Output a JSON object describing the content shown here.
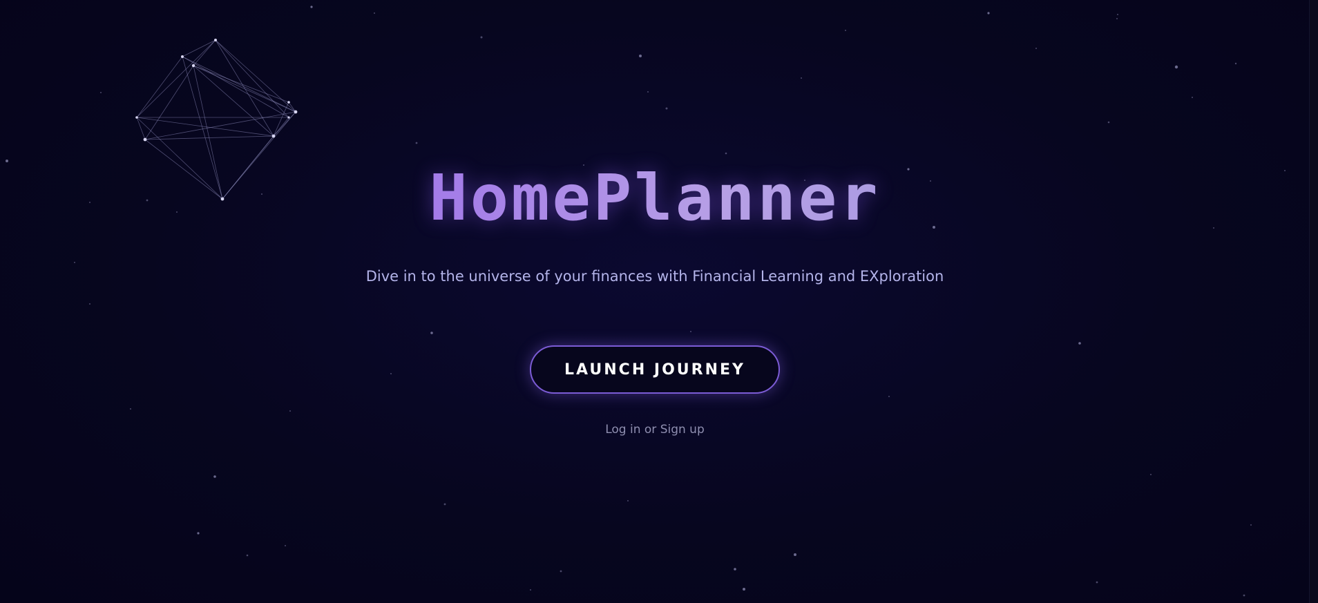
{
  "hero": {
    "title": "HomePlanner",
    "subtitle": "Dive in to the universe of your finances with Financial Learning and EXploration",
    "launch_button_label": "LAUNCH JOURNEY",
    "auth_link_label": "Log in or Sign up"
  },
  "decorations": {
    "background": "starfield",
    "constellation_icon": "constellation-icon"
  },
  "colors": {
    "background": "#06051f",
    "accent": "#8b5cf6",
    "subtitle": "#b4b4ea",
    "button_border": "#7c5cd6",
    "link": "#8f8fb0"
  }
}
